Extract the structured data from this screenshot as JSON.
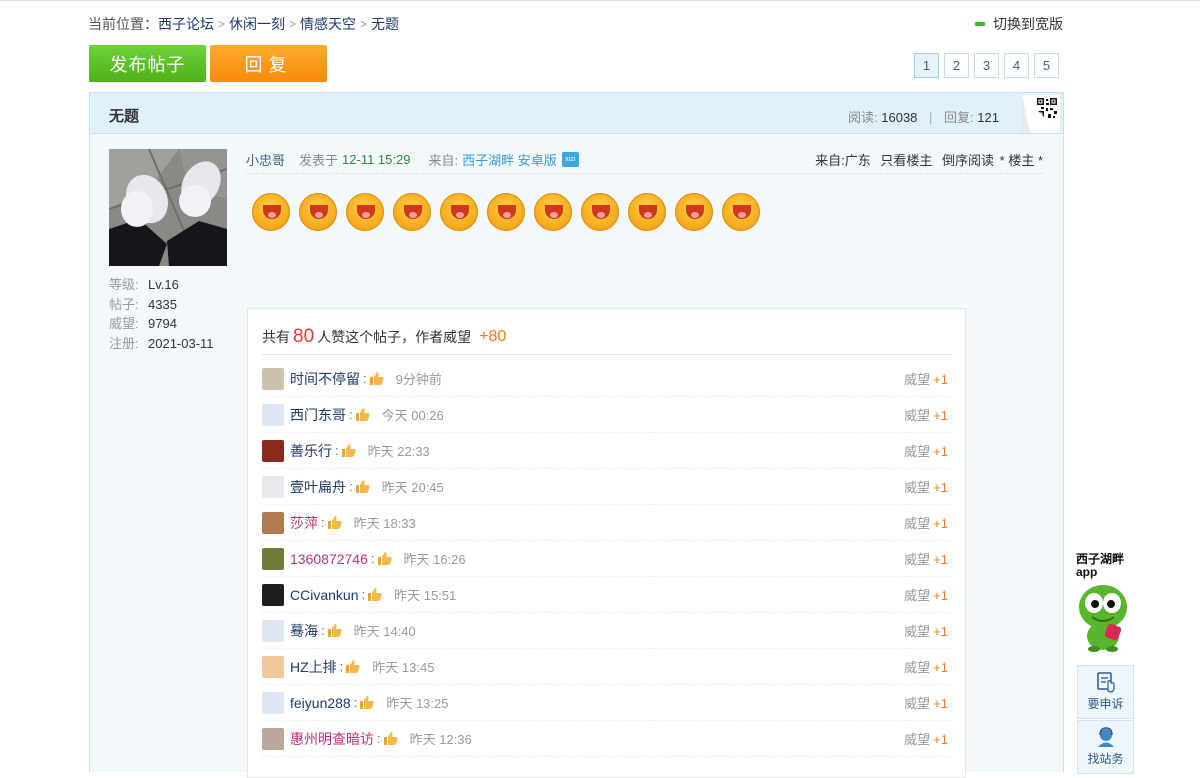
{
  "breadcrumb": {
    "lead": "当前位置：",
    "items": [
      "西子论坛",
      "休闲一刻",
      "情感天空",
      "无题"
    ]
  },
  "wide_toggle": "切换到宽版",
  "actions": {
    "post": "发布帖子",
    "reply": "回复"
  },
  "pager": [
    "1",
    "2",
    "3",
    "4",
    "5"
  ],
  "thread": {
    "title": "无题",
    "views_label": "阅读:",
    "views": "16038",
    "replies_label": "回复:",
    "replies": "121"
  },
  "user": {
    "level_k": "等级:",
    "level_v": "Lv.16",
    "posts_k": "帖子:",
    "posts_v": "4335",
    "rep_k": "威望:",
    "rep_v": "9794",
    "reg_k": "注册:",
    "reg_v": "2021-03-11"
  },
  "post": {
    "author": "小忠哥",
    "posted_label": "发表于",
    "posted_time": "12-11 15:29",
    "from_label": "来自:",
    "from_app": "西子湖畔 安卓版",
    "badge": "xizi",
    "location": "来自:广东",
    "only_author": "只看楼主",
    "reverse": "倒序阅读",
    "floor": "* 楼主 *"
  },
  "emoji_count_note": "11",
  "likes": {
    "prefix": "共有",
    "count": "80",
    "middle": "人赞这个帖子，作者威望",
    "plus": "+80",
    "rep_label": "威望",
    "rep_inc": "+1",
    "items": [
      {
        "name": "时间不停留",
        "time": "9分钟前"
      },
      {
        "name": "西门东哥",
        "time": "今天 00:26"
      },
      {
        "name": "善乐行",
        "time": "昨天 22:33"
      },
      {
        "name": "壹叶扁舟",
        "time": "昨天 20:45"
      },
      {
        "name": "莎萍",
        "time": "昨天 18:33"
      },
      {
        "name": "1360872746",
        "time": "昨天 16:26"
      },
      {
        "name": "CCivankun",
        "time": "昨天 15:51"
      },
      {
        "name": "蓦海",
        "time": "昨天 14:40"
      },
      {
        "name": "HZ上排",
        "time": "昨天 13:45"
      },
      {
        "name": "feiyun288",
        "time": "昨天 13:25"
      },
      {
        "name": "惠州明查暗访",
        "time": "昨天 12:36"
      }
    ]
  },
  "side": {
    "app_title_1": "西子湖畔",
    "app_title_2": "app",
    "complain": "要申诉",
    "find": "找站务"
  },
  "colors": {
    "post_button": "#5cc127",
    "reply_button": "#f8961a",
    "header_bg": "#dff2fb",
    "link": "#1f3a6b",
    "increment": "#f27a1a"
  }
}
